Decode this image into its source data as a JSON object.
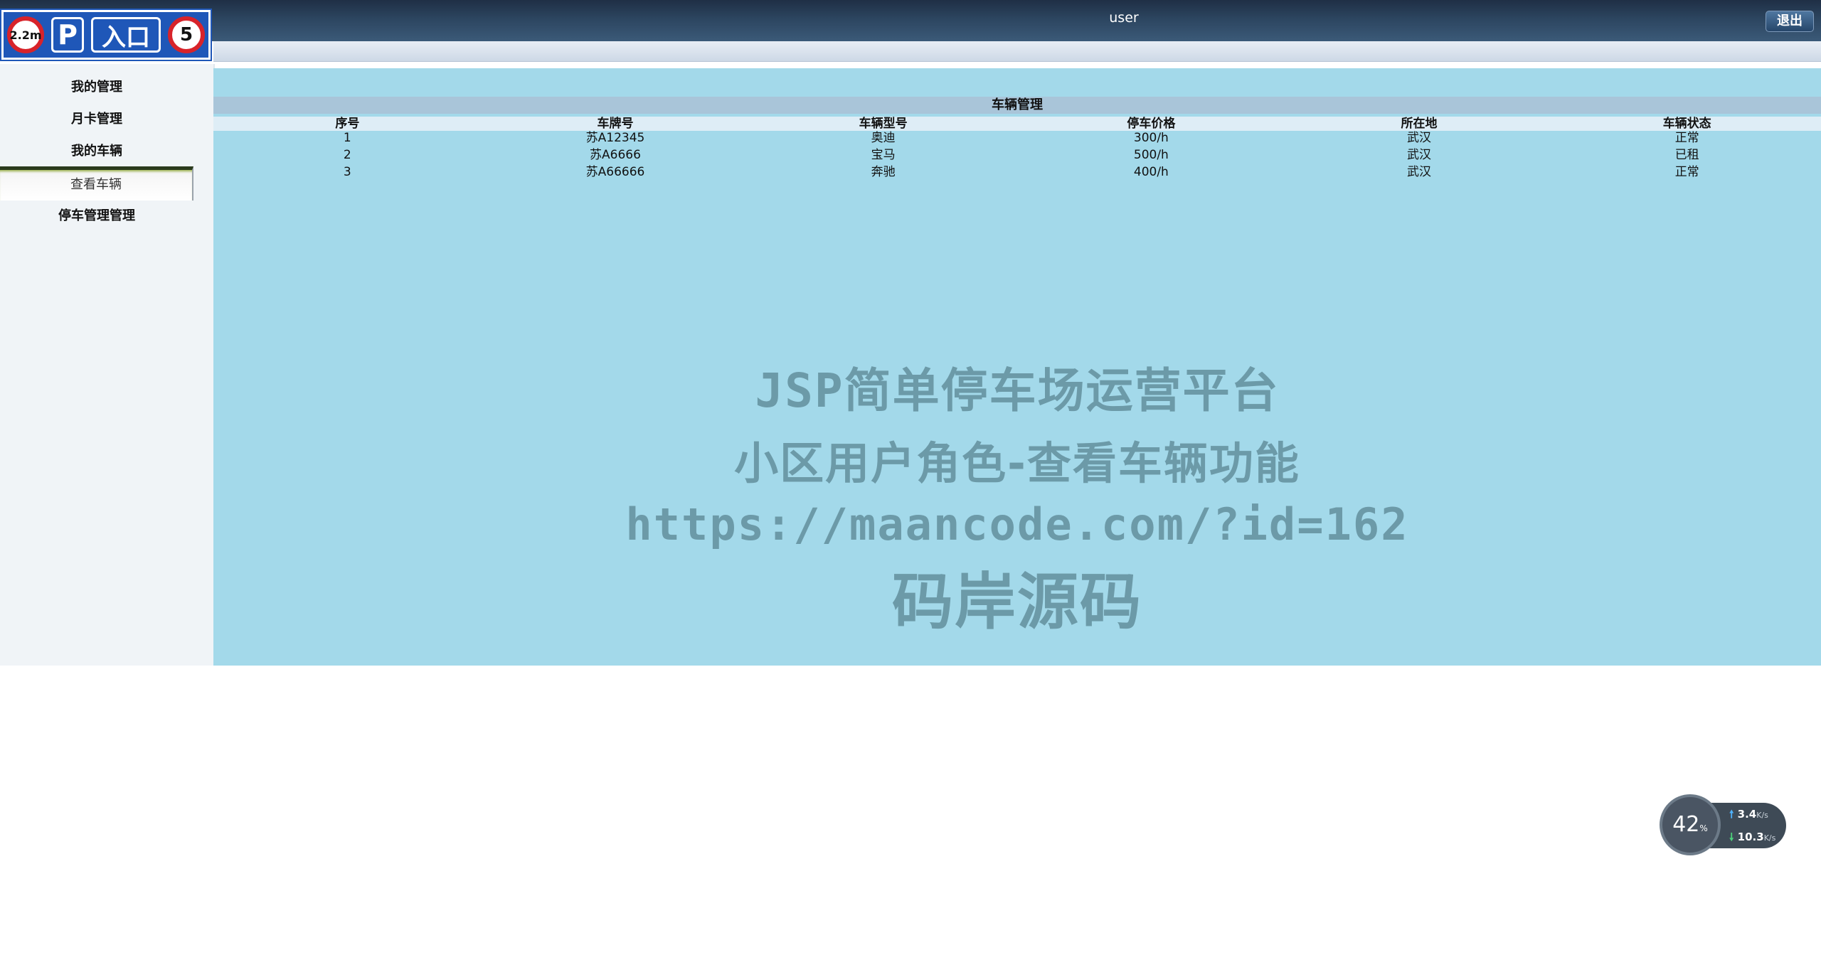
{
  "header": {
    "username": "user",
    "logout_label": "退出"
  },
  "logo": {
    "height_limit": "2.2m",
    "parking_letter": "P",
    "entrance_text": "入口",
    "speed_limit": "5"
  },
  "sidebar": {
    "items": [
      {
        "label": "我的管理"
      },
      {
        "label": "月卡管理"
      },
      {
        "label": "我的车辆"
      },
      {
        "label": "查看车辆"
      },
      {
        "label": "停车管理管理"
      }
    ]
  },
  "main": {
    "table_title": "车辆管理",
    "columns": [
      "序号",
      "车牌号",
      "车辆型号",
      "停车价格",
      "所在地",
      "车辆状态"
    ],
    "rows": [
      [
        "1",
        "苏A12345",
        "奥迪",
        "300/h",
        "武汉",
        "正常"
      ],
      [
        "2",
        "苏A6666",
        "宝马",
        "500/h",
        "武汉",
        "已租"
      ],
      [
        "3",
        "苏A66666",
        "奔驰",
        "400/h",
        "武汉",
        "正常"
      ]
    ]
  },
  "watermark": {
    "line1": "JSP简单停车场运营平台",
    "line2": "小区用户角色-查看车辆功能",
    "line3": "https://maancode.com/?id=162",
    "line4": "码岸源码"
  },
  "netspeed": {
    "percent": "42",
    "percent_unit": "%",
    "upload": "3.4",
    "download": "10.3",
    "unit": "K/s"
  }
}
